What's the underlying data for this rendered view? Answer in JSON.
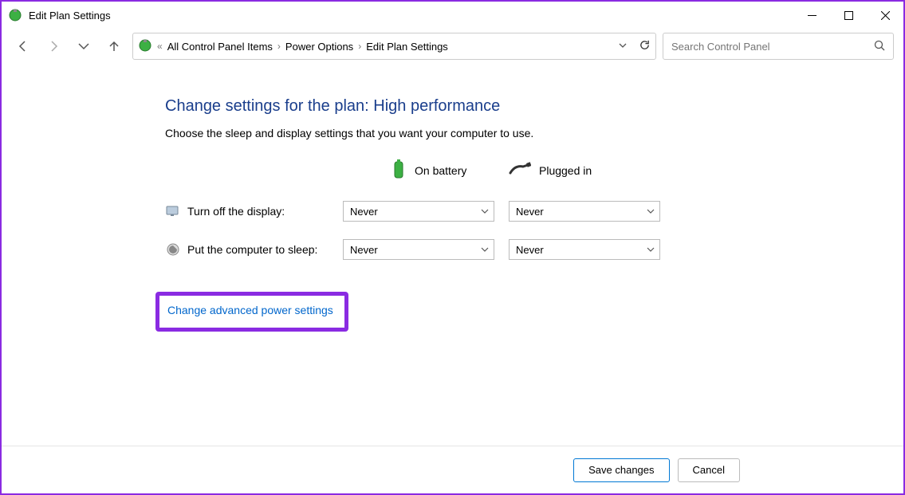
{
  "window": {
    "title": "Edit Plan Settings"
  },
  "breadcrumb": {
    "root_label": "All Control Panel Items",
    "mid_label": "Power Options",
    "leaf_label": "Edit Plan Settings"
  },
  "search": {
    "placeholder": "Search Control Panel"
  },
  "page": {
    "heading": "Change settings for the plan: High performance",
    "description": "Choose the sleep and display settings that you want your computer to use.",
    "col_battery": "On battery",
    "col_plugged": "Plugged in",
    "row_display_label": "Turn off the display:",
    "row_sleep_label": "Put the computer to sleep:",
    "display_battery_value": "Never",
    "display_plugged_value": "Never",
    "sleep_battery_value": "Never",
    "sleep_plugged_value": "Never",
    "advanced_link": "Change advanced power settings"
  },
  "footer": {
    "save_label": "Save changes",
    "cancel_label": "Cancel"
  }
}
